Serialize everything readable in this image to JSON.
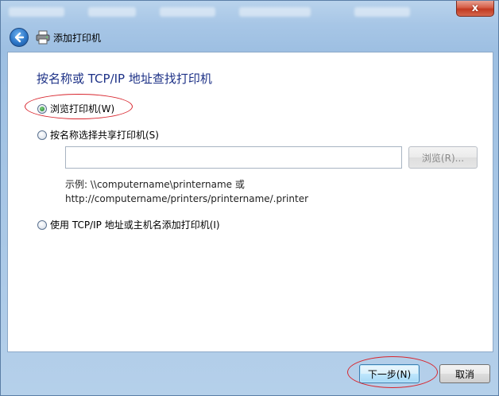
{
  "window": {
    "header_title": "添加打印机",
    "close_label": "x"
  },
  "wizard": {
    "heading": "按名称或 TCP/IP 地址查找打印机",
    "options": [
      {
        "label": "浏览打印机(W)",
        "checked": true
      },
      {
        "label": "按名称选择共享打印机(S)",
        "checked": false
      },
      {
        "label": "使用 TCP/IP 地址或主机名添加打印机(I)",
        "checked": false
      }
    ],
    "share_input": {
      "value": "",
      "placeholder": ""
    },
    "browse_label": "浏览(R)...",
    "example_line1": "示例: \\\\computername\\printername 或",
    "example_line2": "http://computername/printers/printername/.printer"
  },
  "footer": {
    "next_label": "下一步(N)",
    "cancel_label": "取消"
  },
  "colors": {
    "heading": "#1e3287",
    "highlight": "#d8252d",
    "close": "#c23a21"
  },
  "icons": {
    "back": "back-arrow-icon",
    "printer": "printer-icon",
    "close": "close-icon"
  }
}
